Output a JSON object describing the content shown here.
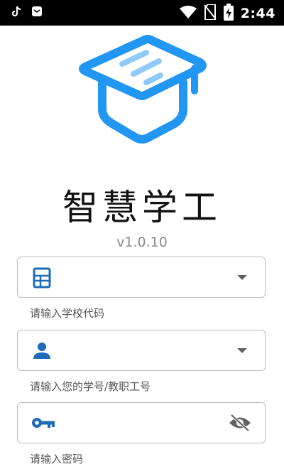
{
  "status_bar": {
    "time": "2:44",
    "icons": [
      "tiktok-icon",
      "app-notification-icon",
      "wifi-icon",
      "no-sim-icon",
      "battery-charging-icon"
    ]
  },
  "app": {
    "title": "智慧学工",
    "version": "v1.0.10",
    "logo": "graduation-cap-icon",
    "brand_color": "#2196F3"
  },
  "form": {
    "school": {
      "icon": "building-icon",
      "hint": "请输入学校代码",
      "control": "chevron-down-icon"
    },
    "student": {
      "icon": "person-icon",
      "hint": "请输入您的学号/教职工号",
      "control": "chevron-down-icon"
    },
    "password": {
      "icon": "key-icon",
      "hint": "请输入密码",
      "control": "eye-off-icon"
    }
  }
}
